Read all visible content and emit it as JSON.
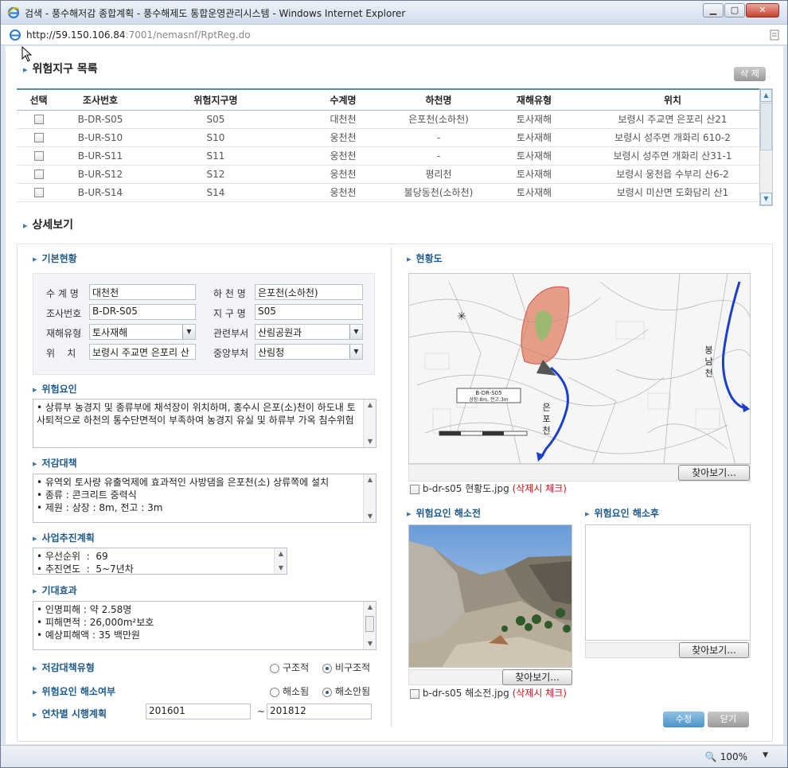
{
  "window": {
    "title": "검색 - 풍수해저감 종합계획 - 풍수해제도 통합운영관리시스템 - Windows Internet Explorer",
    "url_host": "http://59.150.106.84",
    "url_rest": ":7001/nemasnf/RptReg.do",
    "zoom": "100%"
  },
  "list": {
    "title": "위험지구 목록",
    "delete_label": "삭 제",
    "headers": [
      "선택",
      "조사번호",
      "위험지구명",
      "수계명",
      "하천명",
      "재해유형",
      "위치"
    ],
    "rows": [
      {
        "id": "B-DR-S05",
        "name": "S05",
        "basin": "대천천",
        "river": "은포천(소하천)",
        "type": "토사재해",
        "loc": "보령시 주교면 은포리 산21"
      },
      {
        "id": "B-UR-S10",
        "name": "S10",
        "basin": "웅천천",
        "river": "-",
        "type": "토사재해",
        "loc": "보령시 성주면 개화리 610-2"
      },
      {
        "id": "B-UR-S11",
        "name": "S11",
        "basin": "웅천천",
        "river": "-",
        "type": "토사재해",
        "loc": "보령시 성주면 개화리 산31-1"
      },
      {
        "id": "B-UR-S12",
        "name": "S12",
        "basin": "웅천천",
        "river": "평리천",
        "type": "토사재해",
        "loc": "보령시 웅천읍 수부리 산6-2"
      },
      {
        "id": "B-UR-S14",
        "name": "S14",
        "basin": "웅천천",
        "river": "불당동천(소하천)",
        "type": "토사재해",
        "loc": "보령시 미산면 도화담리 산1"
      }
    ]
  },
  "detail": {
    "title": "상세보기",
    "basic": {
      "title": "기본현황",
      "basin_label": "수 계 명",
      "basin_value": "대천천",
      "river_label": "하 천 명",
      "river_value": "은포천(소하천)",
      "survey_label": "조사번호",
      "survey_value": "B-DR-S05",
      "district_label": "지 구 명",
      "district_value": "S05",
      "disaster_label": "재해유형",
      "disaster_value": "토사재해",
      "dept_label": "관련부서",
      "dept_value": "산림공원과",
      "loc_label": "위    치",
      "loc_value": "보령시 주교면 은포리 산",
      "central_label": "중앙부처",
      "central_value": "산림청"
    },
    "risk": {
      "title": "위험요인",
      "text": "• 상류부 농경지 및 종류부에 채석장이 위치하며, 홍수시 은포(소)천이 하도내 토사퇴적으로 하천의 통수단면적이 부족하여 농경지 유실 및 하류부 가옥 침수위험"
    },
    "measure": {
      "title": "저감대책",
      "lines": [
        "• 유역외 토사량 유출억제에 효과적인 사방댐을 은포천(소) 상류쪽에 설치",
        "• 종류 : 콘크리트 중력식",
        "• 제원 : 상장 : 8m, 전고 : 3m"
      ]
    },
    "plan": {
      "title": "사업추진계획",
      "lines": [
        "• 우선순위  :  69",
        "• 추진연도  :  5~7년차"
      ]
    },
    "effect": {
      "title": "기대효과",
      "lines": [
        "• 인명피해 : 약 2.58명",
        "• 피해면적 : 26,000m²보호",
        "• 예상피해액 : 35 백만원"
      ]
    },
    "measure_type": {
      "title": "저감대책유형",
      "opt1": "구조적",
      "opt2": "비구조적",
      "selected": "비구조적"
    },
    "resolved": {
      "title": "위험요인 해소여부",
      "opt1": "해소됨",
      "opt2": "해소안됨",
      "selected": "해소안됨"
    },
    "schedule": {
      "title": "연차별 시행계획",
      "from": "201601",
      "tilde": "~",
      "to": "201812"
    },
    "map": {
      "title": "현황도",
      "browse": "찾아보기...",
      "file": "b-dr-s05 현황도.jpg",
      "delete_hint": "(삭제시 체크)",
      "label_box": "B-DR-S05",
      "label_sub": "상장:8m, 전고:3m",
      "river_label_left": "은 포 천",
      "river_label_right": "봉 남 천"
    },
    "before": {
      "title": "위험요인 해소전",
      "browse": "찾아보기...",
      "file": "b-dr-s05 해소전.jpg",
      "delete_hint": "(삭제시 체크)"
    },
    "after": {
      "title": "위험요인 해소후",
      "browse": "찾아보기..."
    },
    "save_label": "수정",
    "close_label": "닫기"
  },
  "colors": {
    "accent": "#1f5a8c",
    "table_border": "#5a8d9a",
    "river": "#1a3fcf",
    "risk_zone": "#e0775a",
    "hint_red": "#c02020"
  }
}
